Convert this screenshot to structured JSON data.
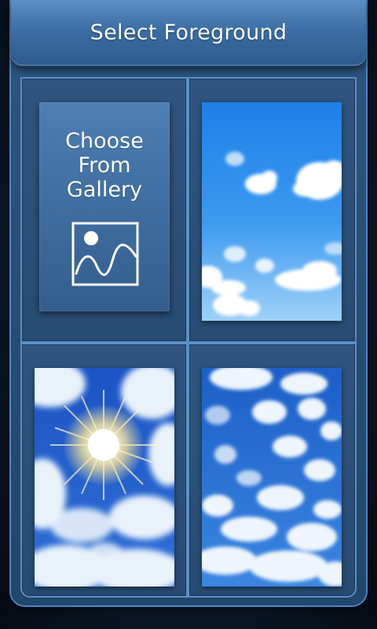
{
  "header": {
    "title": "Select Foreground"
  },
  "gallery_option": {
    "label_lines": [
      "Choose",
      "From",
      "Gallery"
    ],
    "icon": "image-icon"
  },
  "foregrounds": [
    {
      "name": "sky-clouds-light"
    },
    {
      "name": "sky-sunburst"
    },
    {
      "name": "sky-cloud-field"
    }
  ],
  "colors": {
    "accent": "#5c8fc6",
    "header": "#3c6ea5",
    "panel": "#2f5580",
    "sky_light": "#3a8fe8",
    "sky_deep": "#1f5fc9"
  }
}
